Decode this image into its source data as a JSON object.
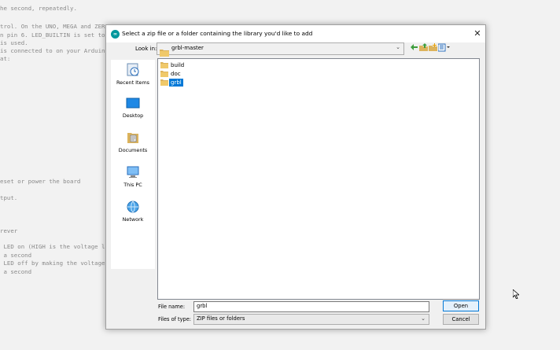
{
  "editor": {
    "lines": [
      "he second, repeatedly.",
      "trol. On the UNO, MEGA and ZERO",
      "n pin 6. LED_BUILTIN is set to",
      "is used.",
      "is connected to on your Arduino",
      "at:",
      "eset or power the board",
      "tput.",
      "rever",
      " LED on (HIGH is the voltage lev",
      " a second",
      " LED off by making the voltage L",
      " a second"
    ]
  },
  "dialog": {
    "title": "Select a zip file or a folder containing the library you'd like to add",
    "app_icon_text": "∞",
    "close_icon": "close-icon",
    "look_in_label": "Look in:",
    "look_in_value": "grbl-master",
    "places": [
      {
        "label": "Recent Items",
        "icon": "recent-items-icon"
      },
      {
        "label": "Desktop",
        "icon": "desktop-icon"
      },
      {
        "label": "Documents",
        "icon": "documents-icon"
      },
      {
        "label": "This PC",
        "icon": "this-pc-icon"
      },
      {
        "label": "Network",
        "icon": "network-icon"
      }
    ],
    "files": [
      {
        "name": "build",
        "selected": false
      },
      {
        "name": "doc",
        "selected": false
      },
      {
        "name": "grbl",
        "selected": true
      }
    ],
    "file_name_label": "File name:",
    "file_name_value": "grbl",
    "files_of_type_label": "Files of type:",
    "files_of_type_value": "ZIP files or folders",
    "open_label": "Open",
    "cancel_label": "Cancel"
  },
  "colors": {
    "selection": "#0078d7",
    "folder": "#dcb35c",
    "arduino_teal": "#00979c"
  }
}
